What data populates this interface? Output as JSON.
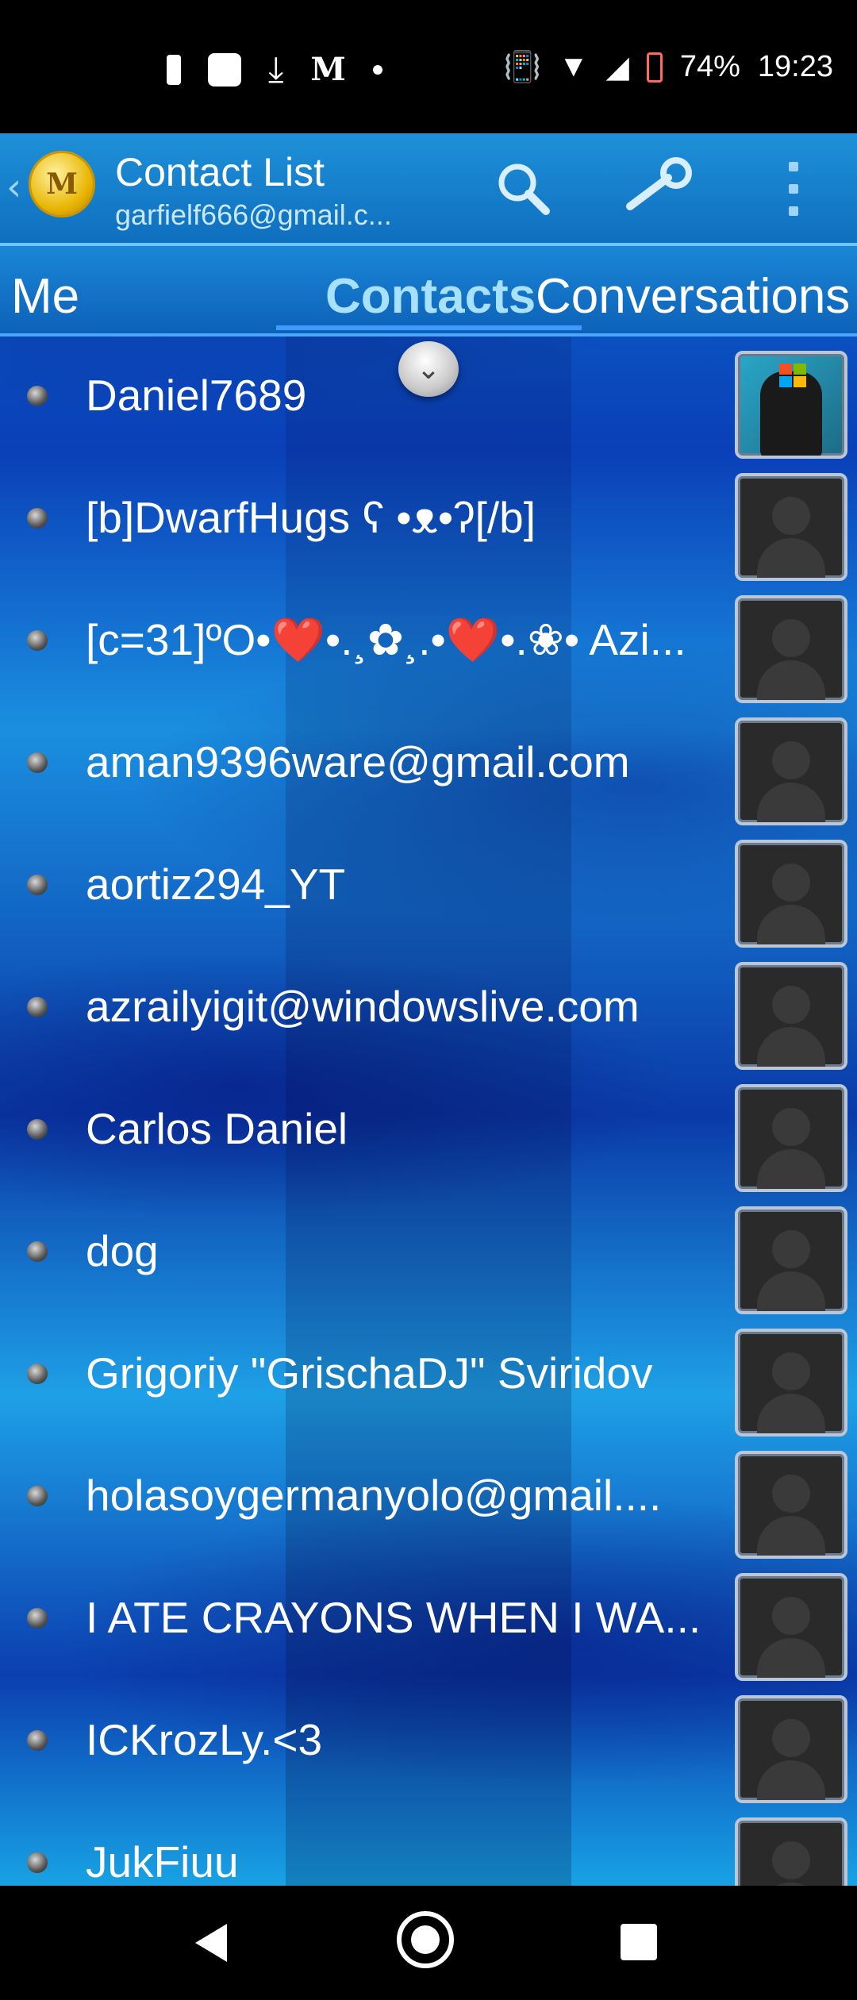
{
  "status_bar": {
    "gmail_glyph": "M",
    "battery_percent": "74%",
    "time": "19:23"
  },
  "header": {
    "title": "Contact List",
    "account": "garfielf666@gmail.c..."
  },
  "tabs": [
    "Me",
    "Contacts",
    "Conversations"
  ],
  "contacts": [
    {
      "name": "Daniel7689",
      "avatar": "photo"
    },
    {
      "name": "[b]DwarfHugs ʕ •ᴥ•ʔ[/b]",
      "avatar": "placeholder"
    },
    {
      "name": "[c=31]ºO•❤️•.¸✿¸.•❤️•.❀• Azi...",
      "avatar": "placeholder"
    },
    {
      "name": "aman9396ware@gmail.com",
      "avatar": "placeholder"
    },
    {
      "name": "aortiz294_YT",
      "avatar": "placeholder"
    },
    {
      "name": "azrailyigit@windowslive.com",
      "avatar": "placeholder"
    },
    {
      "name": "Carlos Daniel",
      "avatar": "placeholder"
    },
    {
      "name": "dog",
      "avatar": "placeholder"
    },
    {
      "name": "Grigoriy \"GrischaDJ\" Sviridov",
      "avatar": "placeholder"
    },
    {
      "name": "holasoygermanyolo@gmail....",
      "avatar": "placeholder"
    },
    {
      "name": "I ATE CRAYONS WHEN I WA...",
      "avatar": "placeholder"
    },
    {
      "name": "ICKrozLy.<3",
      "avatar": "placeholder"
    },
    {
      "name": "JukFiuu",
      "avatar": "placeholder"
    }
  ]
}
